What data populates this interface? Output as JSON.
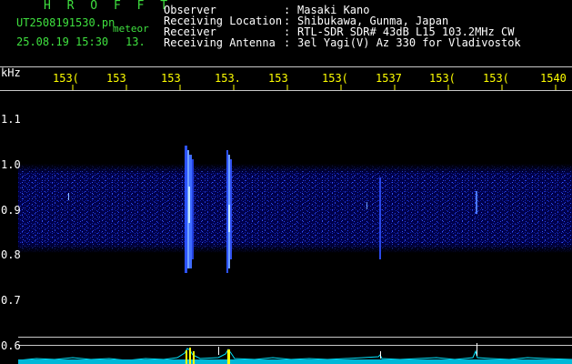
{
  "header": {
    "brand": "H R O F F T",
    "filename": "UT2508191530.pn",
    "meteor_tag": "meteor",
    "datetime": "25.08.19 15:30",
    "counter": "13."
  },
  "info": [
    {
      "label": "Observer",
      "value": "Masaki Kano"
    },
    {
      "label": "Receiving Location",
      "value": "Shibukawa, Gunma, Japan"
    },
    {
      "label": "Receiver",
      "value": "RTL-SDR SDR# 43dB L15 103.2MHz CW"
    },
    {
      "label": "Receiving Antenna",
      "value": "3el Yagi(V) Az 330 for Vladivostok"
    }
  ],
  "separator": ":",
  "axes": {
    "y_unit": "kHz",
    "y_ticks": [
      "1.1",
      "1.0",
      "0.9",
      "0.8",
      "0.7",
      "0.6"
    ],
    "x_ticks": [
      "153(",
      "153",
      "153",
      "153.",
      "153",
      "153(",
      "1537",
      "153(",
      "153(",
      "1540"
    ]
  },
  "colors": {
    "label_green": "#3fe03f",
    "tick_yellow": "#ffff00",
    "text_white": "#ffffff",
    "signal_blue": "#2244ee",
    "trace_cyan": "#00e5ff"
  }
}
